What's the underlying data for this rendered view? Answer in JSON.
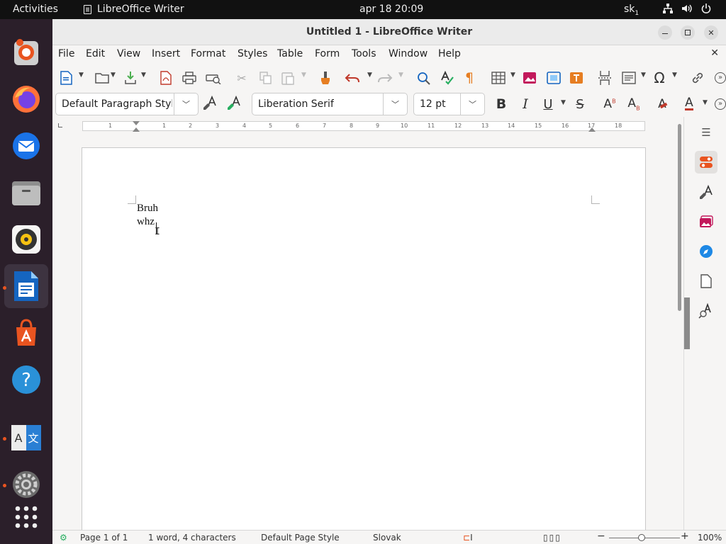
{
  "topbar": {
    "activities": "Activities",
    "app_name": "LibreOffice Writer",
    "clock": "apr 18  20:09",
    "keyboard": "sk",
    "keyboard_sub": "1"
  },
  "dock": {
    "items": [
      {
        "name": "ubuntu-installer",
        "icon": "installer-icon"
      },
      {
        "name": "firefox",
        "icon": "firefox-icon"
      },
      {
        "name": "thunderbird",
        "icon": "mail-icon"
      },
      {
        "name": "files",
        "icon": "files-icon"
      },
      {
        "name": "rhythmbox",
        "icon": "music-icon"
      },
      {
        "name": "libreoffice-writer",
        "icon": "writer-icon"
      },
      {
        "name": "app-center",
        "icon": "app-center-icon"
      },
      {
        "name": "help",
        "icon": "help-icon",
        "glyph": "?"
      },
      {
        "name": "language-support",
        "icon": "translate-icon",
        "glyph_a": "A",
        "glyph_b": "文"
      },
      {
        "name": "settings",
        "icon": "settings-icon"
      },
      {
        "name": "show-apps",
        "icon": "grid-icon"
      }
    ]
  },
  "window": {
    "title": "Untitled 1 - LibreOffice Writer"
  },
  "menubar": {
    "items": [
      "File",
      "Edit",
      "View",
      "Insert",
      "Format",
      "Styles",
      "Table",
      "Form",
      "Tools",
      "Window",
      "Help"
    ]
  },
  "format_bar": {
    "paragraph_style": "Default Paragraph Styl",
    "font_name": "Liberation Serif",
    "font_size": "12 pt"
  },
  "ruler": {
    "labels": [
      "1",
      "1",
      "2",
      "3",
      "4",
      "5",
      "6",
      "7",
      "8",
      "9",
      "10",
      "11",
      "12",
      "13",
      "14",
      "15",
      "16",
      "17",
      "18"
    ]
  },
  "document": {
    "lines": [
      "Bruh",
      "whz"
    ]
  },
  "statusbar": {
    "page": "Page 1 of 1",
    "words": "1 word, 4 characters",
    "page_style": "Default Page Style",
    "language": "Slovak",
    "zoom": "100%",
    "zoom_minus": "−",
    "zoom_plus": "+"
  },
  "colors": {
    "accent": "#e95420",
    "dock_bg": "#2b1f2a",
    "topbar_bg": "#111111"
  }
}
